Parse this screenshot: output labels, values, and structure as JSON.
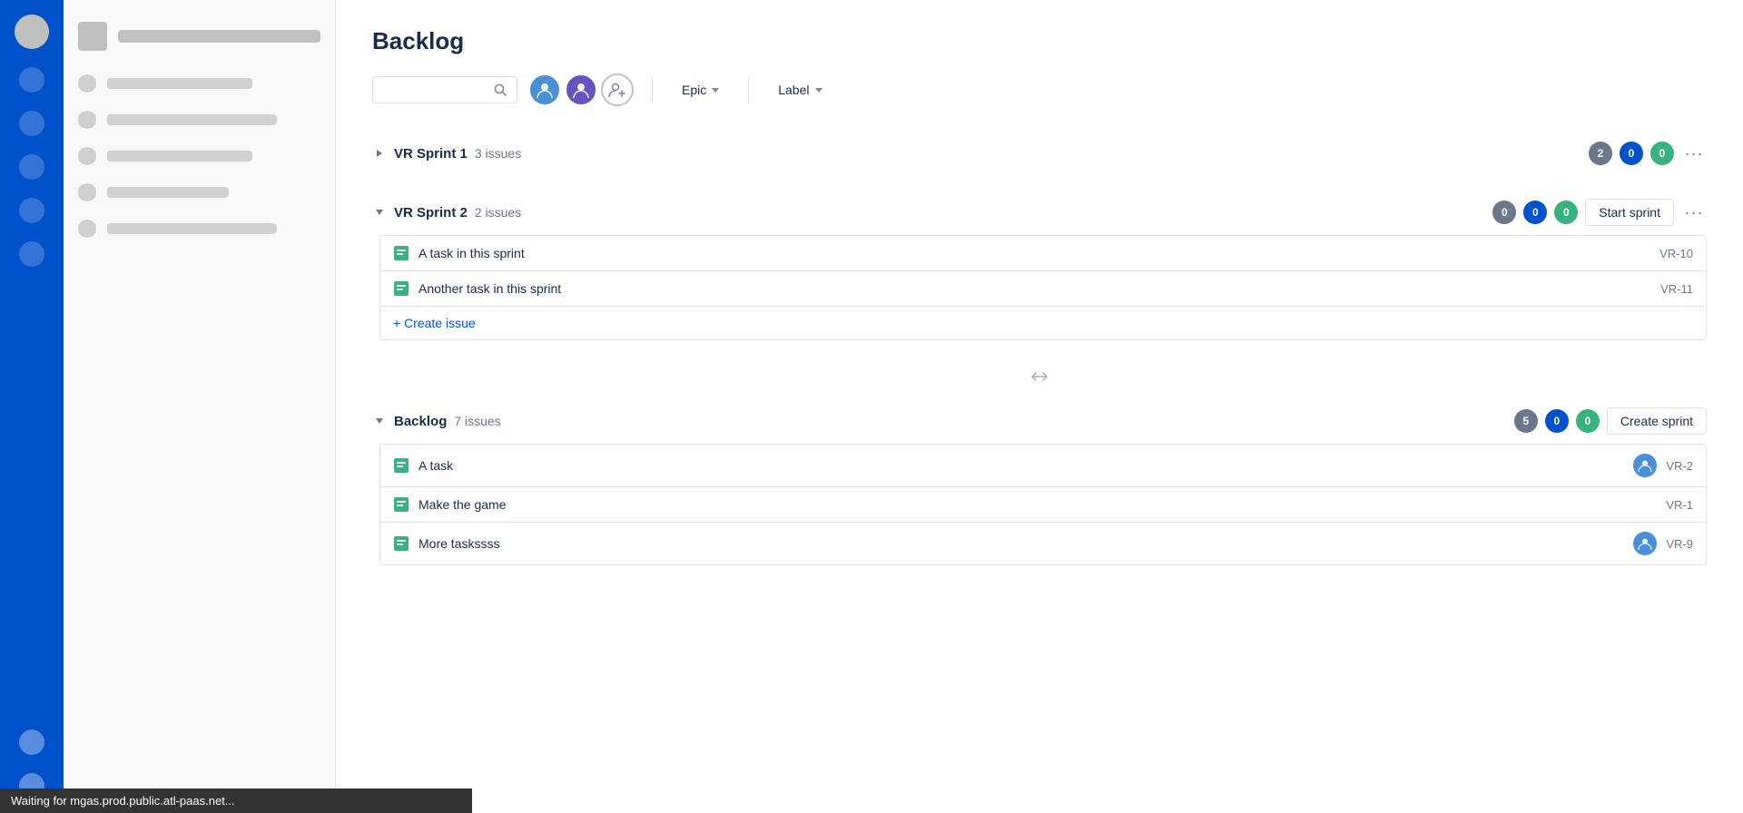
{
  "page": {
    "title": "Backlog",
    "status_bar": "Waiting for mgas.prod.public.atl-paas.net..."
  },
  "toolbar": {
    "search_placeholder": "",
    "epic_label": "Epic",
    "label_label": "Label"
  },
  "sprints": [
    {
      "id": "sprint1",
      "name": "VR Sprint 1",
      "count_label": "3 issues",
      "expanded": false,
      "badges": [
        {
          "value": "2",
          "type": "gray"
        },
        {
          "value": "0",
          "type": "blue"
        },
        {
          "value": "0",
          "type": "green"
        }
      ],
      "show_start": false,
      "show_more": true,
      "items": []
    },
    {
      "id": "sprint2",
      "name": "VR Sprint 2",
      "count_label": "2 issues",
      "expanded": true,
      "badges": [
        {
          "value": "0",
          "type": "gray"
        },
        {
          "value": "0",
          "type": "blue"
        },
        {
          "value": "0",
          "type": "green"
        }
      ],
      "show_start": true,
      "start_label": "Start sprint",
      "show_more": true,
      "items": [
        {
          "name": "A task in this sprint",
          "id": "VR-10",
          "has_avatar": false
        },
        {
          "name": "Another task in this sprint",
          "id": "VR-11",
          "has_avatar": false
        }
      ]
    }
  ],
  "backlog": {
    "name": "Backlog",
    "count_label": "7 issues",
    "badges": [
      {
        "value": "5",
        "type": "gray"
      },
      {
        "value": "0",
        "type": "blue"
      },
      {
        "value": "0",
        "type": "green"
      }
    ],
    "create_sprint_label": "Create sprint",
    "items": [
      {
        "name": "A task",
        "id": "VR-2",
        "has_avatar": true
      },
      {
        "name": "Make the game",
        "id": "VR-1",
        "has_avatar": false
      },
      {
        "name": "More taskssss",
        "id": "VR-9",
        "has_avatar": true
      }
    ]
  },
  "create_issue_label": "+ Create issue",
  "icons": {
    "task": "📋",
    "search": "🔍",
    "more": "···"
  }
}
